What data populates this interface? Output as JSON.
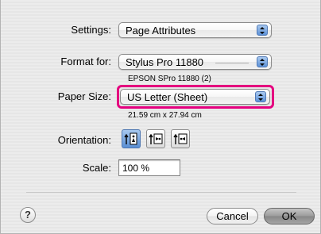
{
  "settings": {
    "label": "Settings:",
    "value": "Page Attributes"
  },
  "format_for": {
    "label": "Format for:",
    "value": "Stylus Pro 11880",
    "subtitle": "EPSON SPro 11880 (2)"
  },
  "paper_size": {
    "label": "Paper Size:",
    "value": "US Letter (Sheet)",
    "dimensions": "21.59 cm x 27.94 cm"
  },
  "orientation": {
    "label": "Orientation:",
    "options": [
      "portrait",
      "landscape-left",
      "landscape-right"
    ],
    "selected": "portrait"
  },
  "scale": {
    "label": "Scale:",
    "value": "100 %"
  },
  "buttons": {
    "help": "?",
    "cancel": "Cancel",
    "ok": "OK"
  },
  "colors": {
    "highlight": "#e4007f",
    "selection_blue": "#5a8fd4"
  }
}
